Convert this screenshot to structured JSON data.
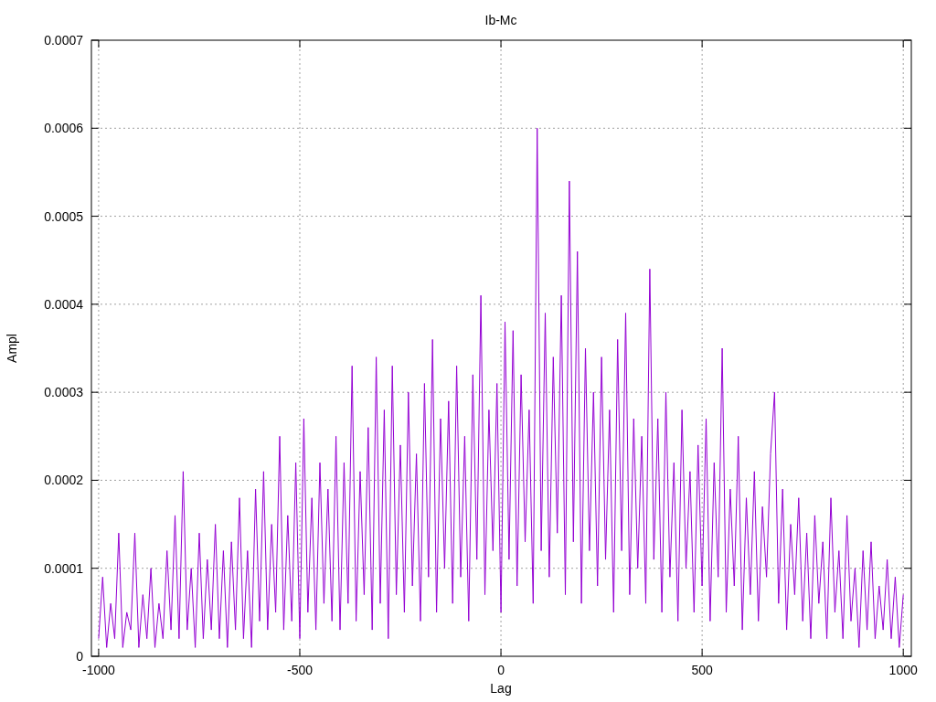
{
  "chart_data": {
    "type": "line",
    "title": "Ib-Mc",
    "xlabel": "Lag",
    "ylabel": "Ampl",
    "grid": true,
    "xlim": [
      -1018,
      1020
    ],
    "ylim": [
      0,
      0.0007
    ],
    "xticks": [
      -1000,
      -500,
      0,
      500,
      1000
    ],
    "yticks": [
      {
        "value": 0,
        "label": "0"
      },
      {
        "value": 0.0001,
        "label": "0.0001"
      },
      {
        "value": 0.0002,
        "label": "0.0002"
      },
      {
        "value": 0.0003,
        "label": "0.0003"
      },
      {
        "value": 0.0004,
        "label": "0.0004"
      },
      {
        "value": 0.0005,
        "label": "0.0005"
      },
      {
        "value": 0.0006,
        "label": "0.0006"
      },
      {
        "value": 0.0007,
        "label": "0.0007"
      }
    ],
    "x": [
      -1000,
      -990,
      -980,
      -970,
      -960,
      -950,
      -940,
      -930,
      -920,
      -910,
      -900,
      -890,
      -880,
      -870,
      -860,
      -850,
      -840,
      -830,
      -820,
      -810,
      -800,
      -790,
      -780,
      -770,
      -760,
      -750,
      -740,
      -730,
      -720,
      -710,
      -700,
      -690,
      -680,
      -670,
      -660,
      -650,
      -640,
      -630,
      -620,
      -610,
      -600,
      -590,
      -580,
      -570,
      -560,
      -550,
      -540,
      -530,
      -520,
      -510,
      -500,
      -490,
      -480,
      -470,
      -460,
      -450,
      -440,
      -430,
      -420,
      -410,
      -400,
      -390,
      -380,
      -370,
      -360,
      -350,
      -340,
      -330,
      -320,
      -310,
      -300,
      -290,
      -280,
      -270,
      -260,
      -250,
      -240,
      -230,
      -220,
      -210,
      -200,
      -190,
      -180,
      -170,
      -160,
      -150,
      -140,
      -130,
      -120,
      -110,
      -100,
      -90,
      -80,
      -70,
      -60,
      -50,
      -40,
      -30,
      -20,
      -10,
      0,
      10,
      20,
      30,
      40,
      50,
      60,
      70,
      80,
      90,
      100,
      110,
      120,
      130,
      140,
      150,
      160,
      170,
      180,
      190,
      200,
      210,
      220,
      230,
      240,
      250,
      260,
      270,
      280,
      290,
      300,
      310,
      320,
      330,
      340,
      350,
      360,
      370,
      380,
      390,
      400,
      410,
      420,
      430,
      440,
      450,
      460,
      470,
      480,
      490,
      500,
      510,
      520,
      530,
      540,
      550,
      560,
      570,
      580,
      590,
      600,
      610,
      620,
      630,
      640,
      650,
      660,
      670,
      680,
      690,
      700,
      710,
      720,
      730,
      740,
      750,
      760,
      770,
      780,
      790,
      800,
      810,
      820,
      830,
      840,
      850,
      860,
      870,
      880,
      890,
      900,
      910,
      920,
      930,
      940,
      950,
      960,
      970,
      980,
      990,
      1000
    ],
    "series": [
      {
        "color": "#9400d3",
        "values": [
          2e-05,
          9e-05,
          1e-05,
          6e-05,
          2e-05,
          0.00014,
          1e-05,
          5e-05,
          3e-05,
          0.00014,
          1e-05,
          7e-05,
          2e-05,
          0.0001,
          1e-05,
          6e-05,
          2e-05,
          0.00012,
          3e-05,
          0.00016,
          2e-05,
          0.00021,
          3e-05,
          0.0001,
          1e-05,
          0.00014,
          2e-05,
          0.00011,
          3e-05,
          0.00015,
          2e-05,
          0.00012,
          1e-05,
          0.00013,
          3e-05,
          0.00018,
          2e-05,
          0.00012,
          1e-05,
          0.00019,
          4e-05,
          0.00021,
          3e-05,
          0.00015,
          5e-05,
          0.00025,
          3e-05,
          0.00016,
          4e-05,
          0.00022,
          2e-05,
          0.00027,
          5e-05,
          0.00018,
          3e-05,
          0.00022,
          6e-05,
          0.00019,
          4e-05,
          0.00025,
          3e-05,
          0.00022,
          6e-05,
          0.00033,
          4e-05,
          0.00021,
          7e-05,
          0.00026,
          3e-05,
          0.00034,
          6e-05,
          0.00028,
          2e-05,
          0.00033,
          7e-05,
          0.00024,
          5e-05,
          0.0003,
          8e-05,
          0.00023,
          4e-05,
          0.00031,
          9e-05,
          0.00036,
          5e-05,
          0.00027,
          0.0001,
          0.00029,
          6e-05,
          0.00033,
          9e-05,
          0.00025,
          4e-05,
          0.00032,
          0.00011,
          0.00041,
          7e-05,
          0.00028,
          0.00012,
          0.00031,
          5e-05,
          0.00038,
          0.00011,
          0.00037,
          8e-05,
          0.00032,
          0.00013,
          0.00028,
          6e-05,
          0.0006,
          0.00012,
          0.00039,
          9e-05,
          0.00034,
          0.00014,
          0.00041,
          7e-05,
          0.00054,
          0.00013,
          0.00046,
          6e-05,
          0.00035,
          0.00012,
          0.0003,
          8e-05,
          0.00034,
          0.00011,
          0.00028,
          5e-05,
          0.00036,
          0.00012,
          0.00039,
          7e-05,
          0.00027,
          0.0001,
          0.00025,
          6e-05,
          0.00044,
          0.00011,
          0.00027,
          5e-05,
          0.0003,
          9e-05,
          0.00022,
          4e-05,
          0.00028,
          0.0001,
          0.00021,
          5e-05,
          0.00024,
          8e-05,
          0.00027,
          4e-05,
          0.00022,
          9e-05,
          0.00035,
          5e-05,
          0.00019,
          8e-05,
          0.00025,
          3e-05,
          0.00018,
          7e-05,
          0.00021,
          4e-05,
          0.00017,
          9e-05,
          0.00023,
          0.0003,
          6e-05,
          0.00019,
          3e-05,
          0.00015,
          7e-05,
          0.00018,
          4e-05,
          0.00014,
          2e-05,
          0.00016,
          6e-05,
          0.00013,
          2e-05,
          0.00018,
          5e-05,
          0.00012,
          2e-05,
          0.00016,
          4e-05,
          0.0001,
          1e-05,
          0.00012,
          3e-05,
          0.00013,
          2e-05,
          8e-05,
          3e-05,
          0.00011,
          2e-05,
          9e-05,
          1e-05,
          7e-05
        ]
      }
    ]
  }
}
